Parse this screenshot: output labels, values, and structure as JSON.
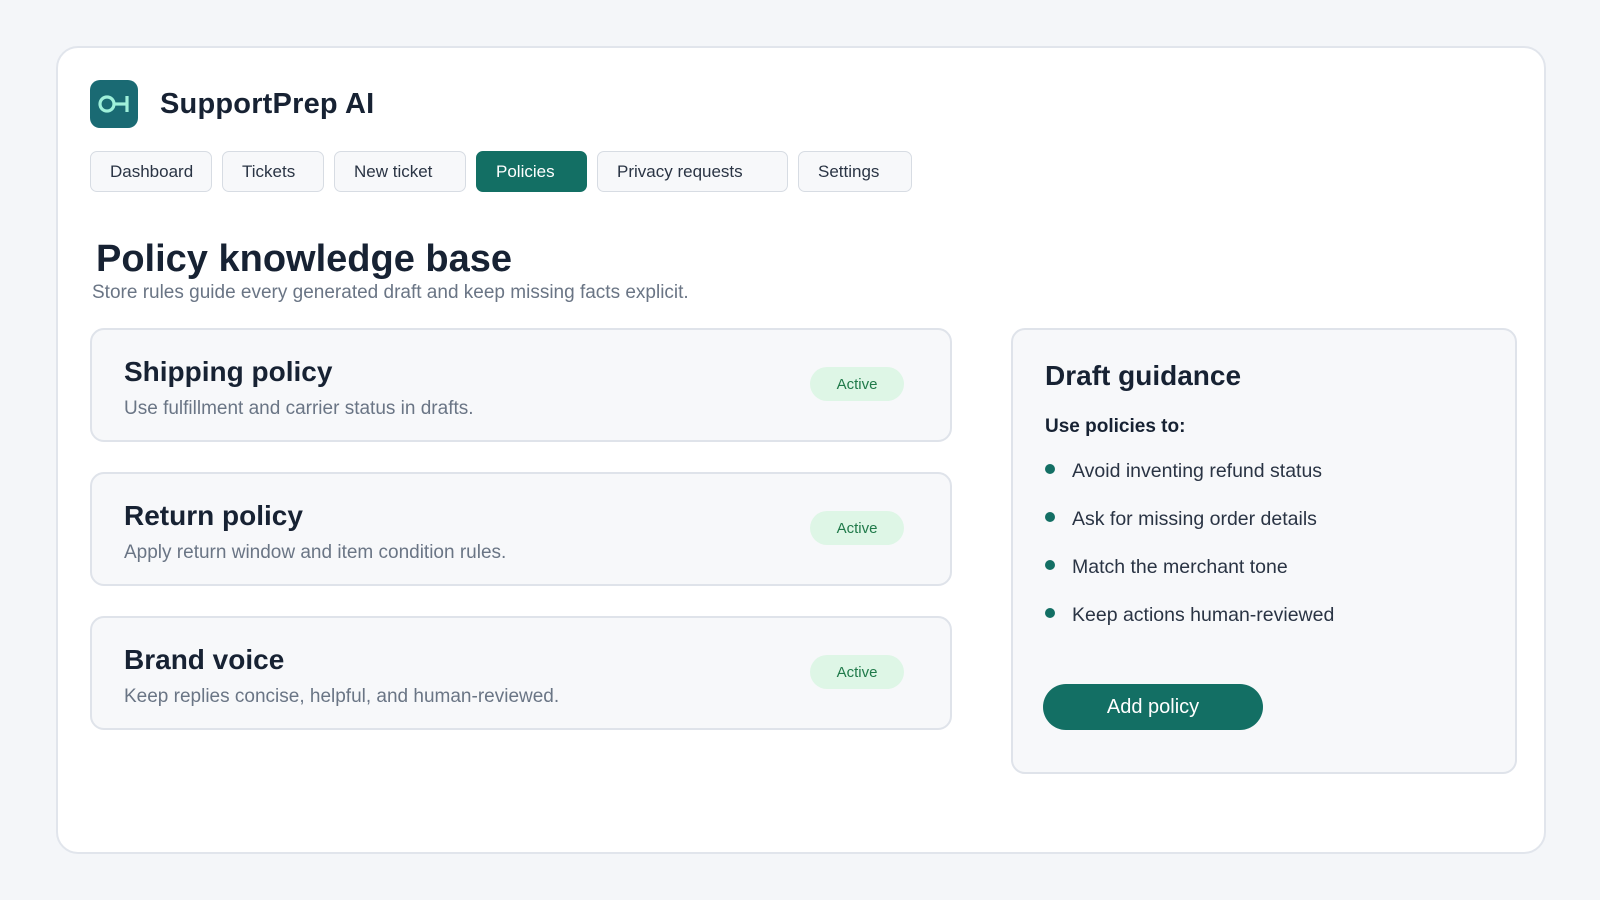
{
  "app": {
    "name": "SupportPrep AI",
    "logo_icon": "link-node-icon",
    "accent_color": "#136f64"
  },
  "nav": {
    "tabs": [
      {
        "label": "Dashboard",
        "active": false
      },
      {
        "label": "Tickets",
        "active": false
      },
      {
        "label": "New ticket",
        "active": false
      },
      {
        "label": "Policies",
        "active": true
      },
      {
        "label": "Privacy requests",
        "active": false
      },
      {
        "label": "Settings",
        "active": false
      }
    ]
  },
  "page": {
    "title": "Policy knowledge base",
    "subtitle": "Store rules guide every generated draft and keep missing facts explicit."
  },
  "policies": [
    {
      "title": "Shipping policy",
      "description": "Use fulfillment and carrier status in drafts.",
      "status": "Active"
    },
    {
      "title": "Return policy",
      "description": "Apply return window and item condition rules.",
      "status": "Active"
    },
    {
      "title": "Brand voice",
      "description": "Keep replies concise, helpful, and human-reviewed.",
      "status": "Active"
    }
  ],
  "guidance": {
    "title": "Draft guidance",
    "subtitle": "Use policies to:",
    "items": [
      "Avoid inventing refund status",
      "Ask for missing order details",
      "Match the merchant tone",
      "Keep actions human-reviewed"
    ],
    "button_label": "Add policy"
  }
}
